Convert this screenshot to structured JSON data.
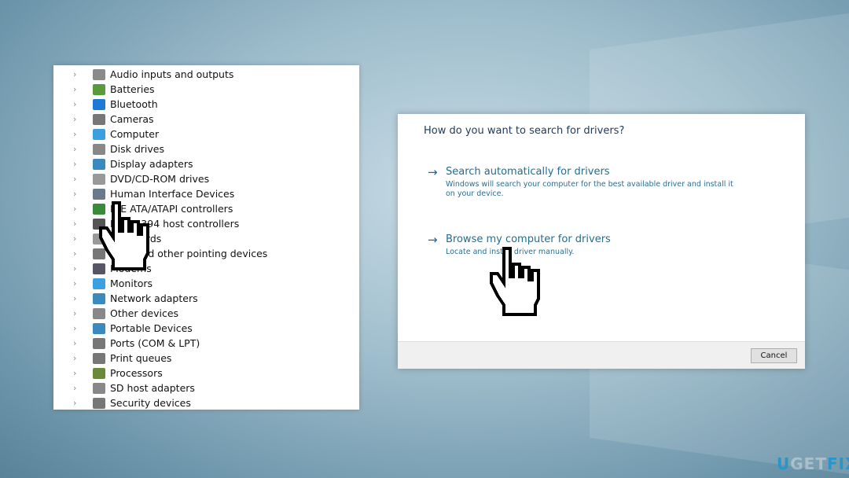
{
  "device_manager": {
    "items": [
      {
        "label": "Audio inputs and outputs",
        "icon": "speaker-icon",
        "color": "#8a8a8a"
      },
      {
        "label": "Batteries",
        "icon": "battery-icon",
        "color": "#5a9a3a"
      },
      {
        "label": "Bluetooth",
        "icon": "bluetooth-icon",
        "color": "#1e7ad6"
      },
      {
        "label": "Cameras",
        "icon": "camera-icon",
        "color": "#777"
      },
      {
        "label": "Computer",
        "icon": "computer-icon",
        "color": "#3aa0e0"
      },
      {
        "label": "Disk drives",
        "icon": "disk-icon",
        "color": "#888"
      },
      {
        "label": "Display adapters",
        "icon": "display-icon",
        "color": "#3a8ac0"
      },
      {
        "label": "DVD/CD-ROM drives",
        "icon": "dvd-icon",
        "color": "#999"
      },
      {
        "label": "Human Interface Devices",
        "icon": "hid-icon",
        "color": "#6a7a8a"
      },
      {
        "label": "IDE ATA/ATAPI controllers",
        "icon": "ide-icon",
        "color": "#3a8a3a"
      },
      {
        "label": "IEEE 1394 host controllers",
        "icon": "plug-icon",
        "color": "#555"
      },
      {
        "label": "Keyboards",
        "icon": "keyboard-icon",
        "color": "#999"
      },
      {
        "label": "Mice and other pointing devices",
        "icon": "mouse-icon",
        "color": "#777"
      },
      {
        "label": "Modems",
        "icon": "modem-icon",
        "color": "#556"
      },
      {
        "label": "Monitors",
        "icon": "monitor-icon",
        "color": "#3aa0e0"
      },
      {
        "label": "Network adapters",
        "icon": "network-icon",
        "color": "#3a8ac0"
      },
      {
        "label": "Other devices",
        "icon": "unknown-device-icon",
        "color": "#888"
      },
      {
        "label": "Portable Devices",
        "icon": "portable-icon",
        "color": "#3a8ac0"
      },
      {
        "label": "Ports (COM & LPT)",
        "icon": "port-icon",
        "color": "#777"
      },
      {
        "label": "Print queues",
        "icon": "printer-icon",
        "color": "#777"
      },
      {
        "label": "Processors",
        "icon": "cpu-icon",
        "color": "#6a8a3a"
      },
      {
        "label": "SD host adapters",
        "icon": "sd-icon",
        "color": "#888"
      },
      {
        "label": "Security devices",
        "icon": "security-icon",
        "color": "#777"
      }
    ]
  },
  "dialog": {
    "question": "How do you want to search for drivers?",
    "options": [
      {
        "title": "Search automatically for drivers",
        "desc": "Windows will search your computer for the best available driver and install it on your device."
      },
      {
        "title": "Browse my computer for drivers",
        "desc": "Locate and install driver manually."
      }
    ],
    "cancel": "Cancel"
  },
  "watermark": "UGETFIX"
}
